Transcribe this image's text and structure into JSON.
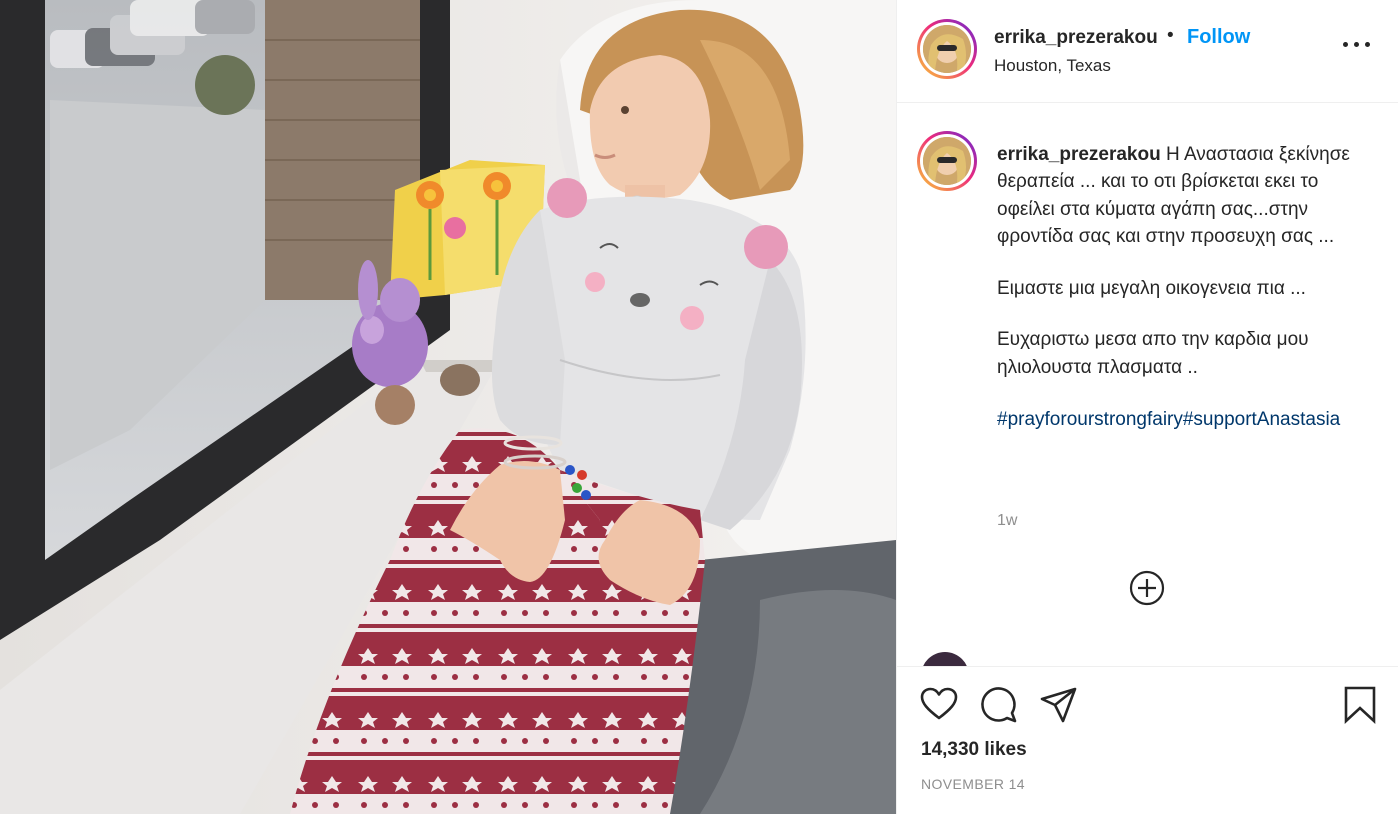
{
  "header": {
    "username": "errika_prezerakou",
    "separator": "•",
    "follow_label": "Follow",
    "location": "Houston, Texas"
  },
  "caption": {
    "username": "errika_prezerakou",
    "paragraphs": [
      "Η Αναστασια ξεκίνησε θεραπεία ... και το οτι βρίσκεται εκει το οφείλει στα κύματα αγάπη σας...στην φροντίδα σας και στην προσευχη σας ...",
      "Ειμαστε μια μεγαλη οικογενεια πια ...",
      "Ευχαριστω μεσα απο την καρδια μου ηλιολουστα πλασματα .."
    ],
    "hashtags": "#prayforourstrongfairy#supportAnastasia",
    "time_ago": "1w"
  },
  "actions": {
    "likes": "14,330 likes",
    "date": "NOVEMBER 14"
  },
  "icons": {
    "more": "more-options-icon",
    "load_more": "plus-circle-icon",
    "like": "heart-icon",
    "comment": "comment-bubble-icon",
    "share": "paper-plane-icon",
    "save": "bookmark-icon"
  },
  "colors": {
    "follow": "#0095f6",
    "hashtag": "#00376b",
    "muted": "#8e8e8e",
    "text": "#262626"
  }
}
